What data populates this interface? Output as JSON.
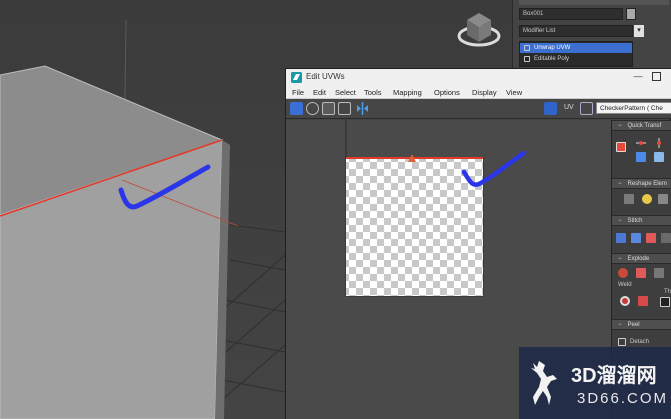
{
  "viewport": {
    "label": "3D perspective viewport"
  },
  "command_panel": {
    "object_name": "Box001",
    "modifier_list_label": "Modifier List",
    "stack": [
      {
        "label": "Unwrap UVW",
        "selected": true
      },
      {
        "label": "Editable Poly",
        "selected": false
      }
    ]
  },
  "uv_editor": {
    "title": "Edit UVWs",
    "menu": [
      "File",
      "Edit",
      "Select",
      "Tools",
      "Mapping",
      "Options",
      "Display",
      "View"
    ],
    "uv_label": "UV",
    "texture_select": "CheckerPattern  ( Che",
    "side_panel": {
      "quick_transform": "Quick Transf",
      "reshape": "Reshape Elem",
      "stitch": "Stitch",
      "explode": "Explode",
      "weld": "Weld",
      "thresh_partial": "Th",
      "peel": "Peel",
      "detach": "Detach"
    }
  },
  "watermark": {
    "line1": "3D溜溜网",
    "line2": "3D66.COM"
  },
  "colors": {
    "edge_highlight": "#e03a2a",
    "annotation_stroke": "#2a36e8",
    "checker_light": "#ffffff",
    "checker_dark": "#c8c8c8",
    "stack_selected": "#3b6fd0"
  }
}
